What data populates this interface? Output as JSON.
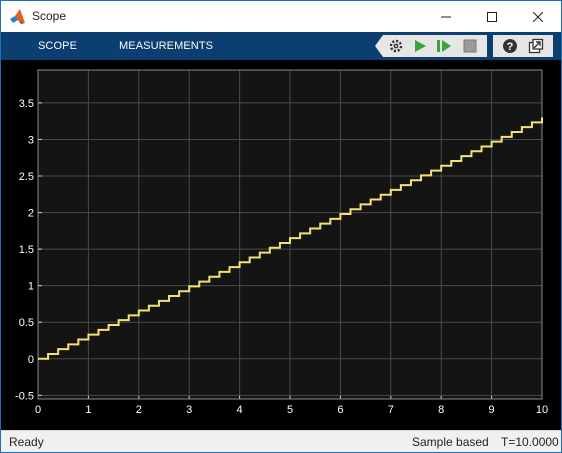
{
  "window": {
    "title": "Scope"
  },
  "toolstrip": {
    "tabs": [
      "SCOPE",
      "MEASUREMENTS"
    ]
  },
  "toolbar": {
    "icons": [
      "settings-gear-icon",
      "run-icon",
      "step-forward-icon",
      "stop-icon",
      "help-icon",
      "undock-icon"
    ],
    "run_color": "#3aa63a",
    "stop_color": "#9a9a9a"
  },
  "status": {
    "state": "Ready",
    "mode": "Sample based",
    "time": "T=10.0000"
  },
  "chart_data": {
    "type": "line",
    "title": "",
    "xlabel": "",
    "ylabel": "",
    "xlim": [
      0,
      10
    ],
    "ylim": [
      -0.55,
      3.95
    ],
    "xticks": [
      "0",
      "1",
      "2",
      "3",
      "4",
      "5",
      "6",
      "7",
      "8",
      "9",
      "10"
    ],
    "yticks": [
      "-0.5",
      "0",
      "0.5",
      "1",
      "1.5",
      "2",
      "2.5",
      "3",
      "3.5"
    ],
    "grid": true,
    "background": "#141414",
    "line_color": "#f5e270",
    "series": [
      {
        "step": true,
        "x_start": 0,
        "x_end": 10,
        "x_step": 0.2,
        "y_step_per_unit_x": 0.33
      }
    ]
  }
}
